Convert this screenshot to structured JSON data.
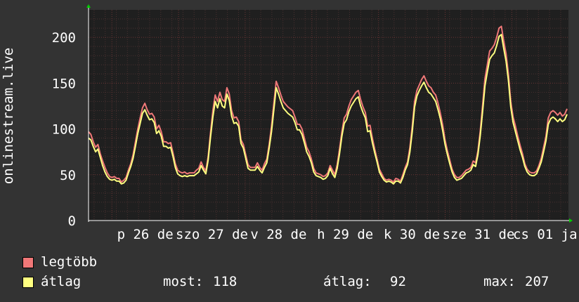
{
  "chart_data": {
    "type": "line",
    "ylabel": "onlinestream.live",
    "ylim": [
      0,
      230
    ],
    "yticks": [
      0,
      50,
      100,
      150,
      200
    ],
    "x_tick_labels": [
      "p 26 de",
      "szo 27 de",
      "v 28 de",
      "h 29 de",
      "k 30 de",
      "sze 31 de",
      "cs 01 ja"
    ],
    "grid": true,
    "legend_placement": "bottom-left",
    "colors": {
      "background": "#333333",
      "plot_background": "#1f1f1f",
      "grid_minor": "#4a3030",
      "grid_major": "#6a3535",
      "axis": "#ffffff",
      "axis_arrow": "#00cc00"
    },
    "series": [
      {
        "name": "legtöbb",
        "color": "#f07878",
        "values": [
          97,
          94,
          86,
          80,
          83,
          73,
          65,
          58,
          52,
          48,
          47,
          48,
          46,
          46,
          42,
          44,
          47,
          55,
          62,
          72,
          86,
          100,
          112,
          123,
          128,
          121,
          116,
          117,
          113,
          100,
          104,
          97,
          86,
          86,
          84,
          85,
          74,
          62,
          55,
          53,
          52,
          53,
          51,
          52,
          52,
          52,
          55,
          57,
          64,
          58,
          54,
          70,
          96,
          120,
          137,
          130,
          140,
          132,
          130,
          145,
          138,
          120,
          112,
          113,
          108,
          88,
          83,
          72,
          61,
          58,
          58,
          58,
          63,
          58,
          55,
          62,
          67,
          83,
          103,
          128,
          152,
          145,
          137,
          130,
          127,
          124,
          122,
          120,
          113,
          105,
          105,
          100,
          90,
          80,
          75,
          67,
          57,
          52,
          51,
          50,
          48,
          49,
          52,
          60,
          55,
          50,
          61,
          78,
          97,
          112,
          116,
          125,
          132,
          136,
          140,
          142,
          132,
          124,
          118,
          103,
          104,
          90,
          78,
          67,
          56,
          51,
          46,
          44,
          45,
          44,
          42,
          46,
          45,
          43,
          50,
          58,
          64,
          80,
          103,
          130,
          142,
          148,
          154,
          158,
          152,
          147,
          145,
          140,
          137,
          128,
          117,
          104,
          88,
          76,
          66,
          56,
          50,
          47,
          47,
          49,
          52,
          55,
          56,
          58,
          65,
          63,
          76,
          98,
          126,
          155,
          170,
          185,
          188,
          192,
          200,
          210,
          212,
          196,
          182,
          160,
          130,
          113,
          103,
          92,
          82,
          73,
          62,
          56,
          53,
          52,
          52,
          54,
          60,
          68,
          80,
          92,
          112,
          118,
          120,
          118,
          115,
          118,
          114,
          116,
          122
        ]
      },
      {
        "name": "átlag",
        "color": "#ffff80",
        "values": [
          90,
          88,
          81,
          75,
          78,
          69,
          60,
          53,
          48,
          45,
          44,
          45,
          43,
          43,
          40,
          41,
          44,
          52,
          59,
          68,
          81,
          95,
          106,
          117,
          121,
          115,
          110,
          111,
          107,
          95,
          98,
          92,
          81,
          81,
          79,
          80,
          70,
          58,
          51,
          49,
          48,
          49,
          48,
          49,
          49,
          49,
          51,
          53,
          60,
          55,
          51,
          66,
          91,
          113,
          130,
          123,
          133,
          125,
          123,
          138,
          131,
          114,
          106,
          107,
          103,
          84,
          79,
          68,
          57,
          55,
          55,
          55,
          59,
          55,
          52,
          58,
          63,
          79,
          97,
          121,
          145,
          138,
          130,
          123,
          120,
          117,
          115,
          113,
          107,
          99,
          99,
          94,
          85,
          75,
          70,
          63,
          53,
          49,
          48,
          47,
          45,
          46,
          49,
          57,
          51,
          47,
          57,
          73,
          92,
          106,
          110,
          119,
          125,
          129,
          133,
          135,
          125,
          118,
          112,
          97,
          98,
          85,
          74,
          64,
          53,
          48,
          44,
          42,
          43,
          42,
          40,
          43,
          43,
          41,
          47,
          55,
          61,
          75,
          97,
          124,
          136,
          142,
          147,
          151,
          145,
          140,
          138,
          134,
          130,
          121,
          111,
          98,
          83,
          72,
          62,
          53,
          47,
          44,
          45,
          46,
          49,
          52,
          53,
          55,
          61,
          59,
          72,
          93,
          119,
          147,
          162,
          176,
          180,
          183,
          191,
          201,
          203,
          188,
          174,
          153,
          124,
          107,
          97,
          87,
          77,
          69,
          59,
          53,
          50,
          49,
          49,
          51,
          57,
          64,
          75,
          87,
          105,
          111,
          113,
          111,
          108,
          111,
          108,
          110,
          116
        ]
      }
    ],
    "stats": {
      "most_label": "most:",
      "most_value": "118",
      "atlag_label": "átlag:",
      "atlag_value": "92",
      "max_label": "max:",
      "max_value": "207"
    }
  }
}
